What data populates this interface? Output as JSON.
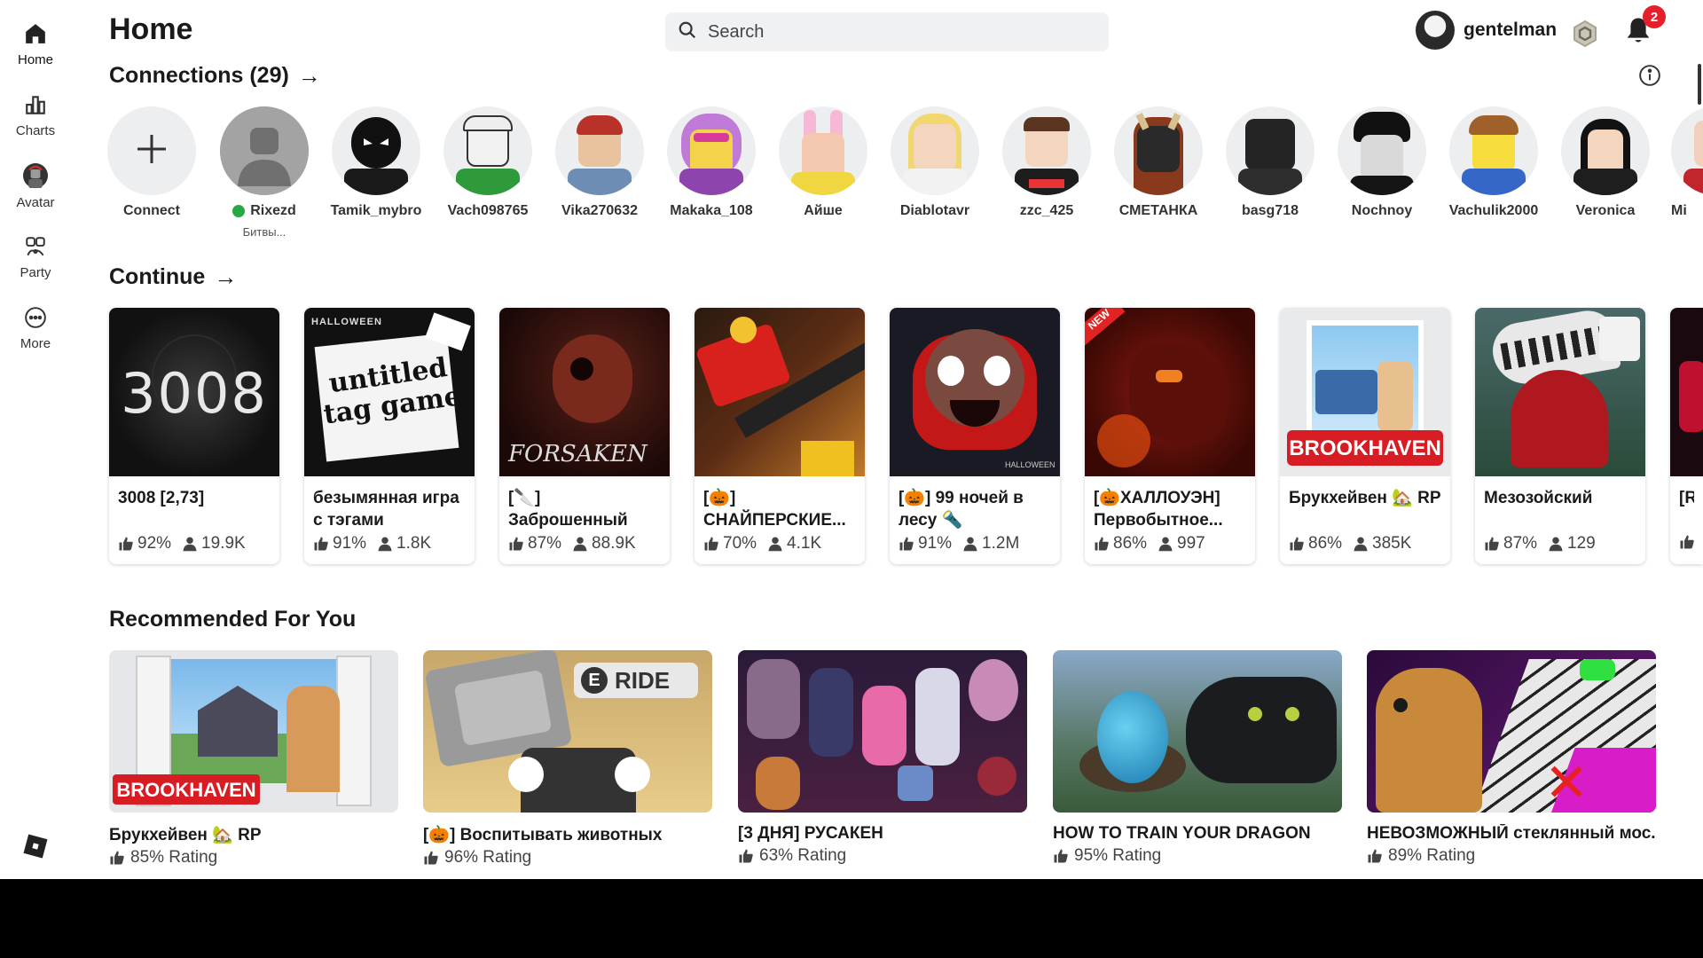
{
  "sidebar": {
    "items": [
      {
        "label": "Home",
        "icon": "home-icon"
      },
      {
        "label": "Charts",
        "icon": "chart-icon"
      },
      {
        "label": "Avatar",
        "icon": "avatar-icon"
      },
      {
        "label": "Party",
        "icon": "party-icon"
      },
      {
        "label": "More",
        "icon": "more-icon"
      }
    ]
  },
  "header": {
    "title": "Home",
    "search_placeholder": "Search",
    "username": "gentelman",
    "notification_count": "2"
  },
  "connections": {
    "title": "Connections (29)",
    "items": [
      {
        "name": "Connect"
      },
      {
        "name": "Rixezd",
        "status": "Битвы..."
      },
      {
        "name": "Tamik_mybro"
      },
      {
        "name": "Vach098765"
      },
      {
        "name": "Vika270632"
      },
      {
        "name": "Makaka_108"
      },
      {
        "name": "Айше"
      },
      {
        "name": "Diablotavr"
      },
      {
        "name": "zzc_425"
      },
      {
        "name": "СМЕТАНКА"
      },
      {
        "name": "basg718"
      },
      {
        "name": "Nochnoy"
      },
      {
        "name": "Vachulik2000"
      },
      {
        "name": "Veronica"
      },
      {
        "name": "Mi"
      }
    ]
  },
  "continue": {
    "title": "Continue",
    "items": [
      {
        "title": "3008 [2,73]",
        "rating": "92%",
        "players": "19.9K"
      },
      {
        "title": "безымянная игра с тэгами",
        "rating": "91%",
        "players": "1.8K"
      },
      {
        "title": "[🔪] Заброшенный",
        "rating": "87%",
        "players": "88.9K"
      },
      {
        "title": "[🎃] СНАЙПЕРСКИЕ...",
        "rating": "70%",
        "players": "4.1K"
      },
      {
        "title": "[🎃] 99 ночей в лесу 🔦",
        "rating": "91%",
        "players": "1.2M"
      },
      {
        "title": "[🎃ХАЛЛОУЭН] Первобытное...",
        "rating": "86%",
        "players": "997"
      },
      {
        "title": "Брукхейвен 🏡 RP",
        "rating": "86%",
        "players": "385K"
      },
      {
        "title": "Мезозойский",
        "rating": "87%",
        "players": "129"
      },
      {
        "title": "[R] Юр",
        "rating": "",
        "players": ""
      }
    ],
    "thumb_texts": {
      "t3008": "3008",
      "halloween": "HALLOWEEN",
      "untitled": "untitled tag game",
      "forsaken": "FORSAKEN",
      "new": "NEW",
      "brookhaven": "BROOKHAVEN",
      "halloween2": "HALLOWEEN"
    }
  },
  "recommended": {
    "title": "Recommended For You",
    "items": [
      {
        "title": "Брукхейвен 🏡 RP",
        "rating": "85% Rating"
      },
      {
        "title": "[🎃] Воспитывать животных",
        "rating": "96% Rating"
      },
      {
        "title": "[3 ДНЯ] РУСАКЕН",
        "rating": "63% Rating"
      },
      {
        "title": "HOW TO TRAIN YOUR DRAGON",
        "rating": "95% Rating"
      },
      {
        "title": "НЕВОЗМОЖНЫЙ стеклянный мос...",
        "rating": "89% Rating"
      }
    ],
    "thumb_texts": {
      "brookhaven": "BROOKHAVEN",
      "ride": "RIDE",
      "ride_key": "E"
    }
  },
  "colors": {
    "accent_red": "#e5202a",
    "online_green": "#28a745",
    "background": "#ffffff",
    "search_bg": "#f0f1f3"
  }
}
